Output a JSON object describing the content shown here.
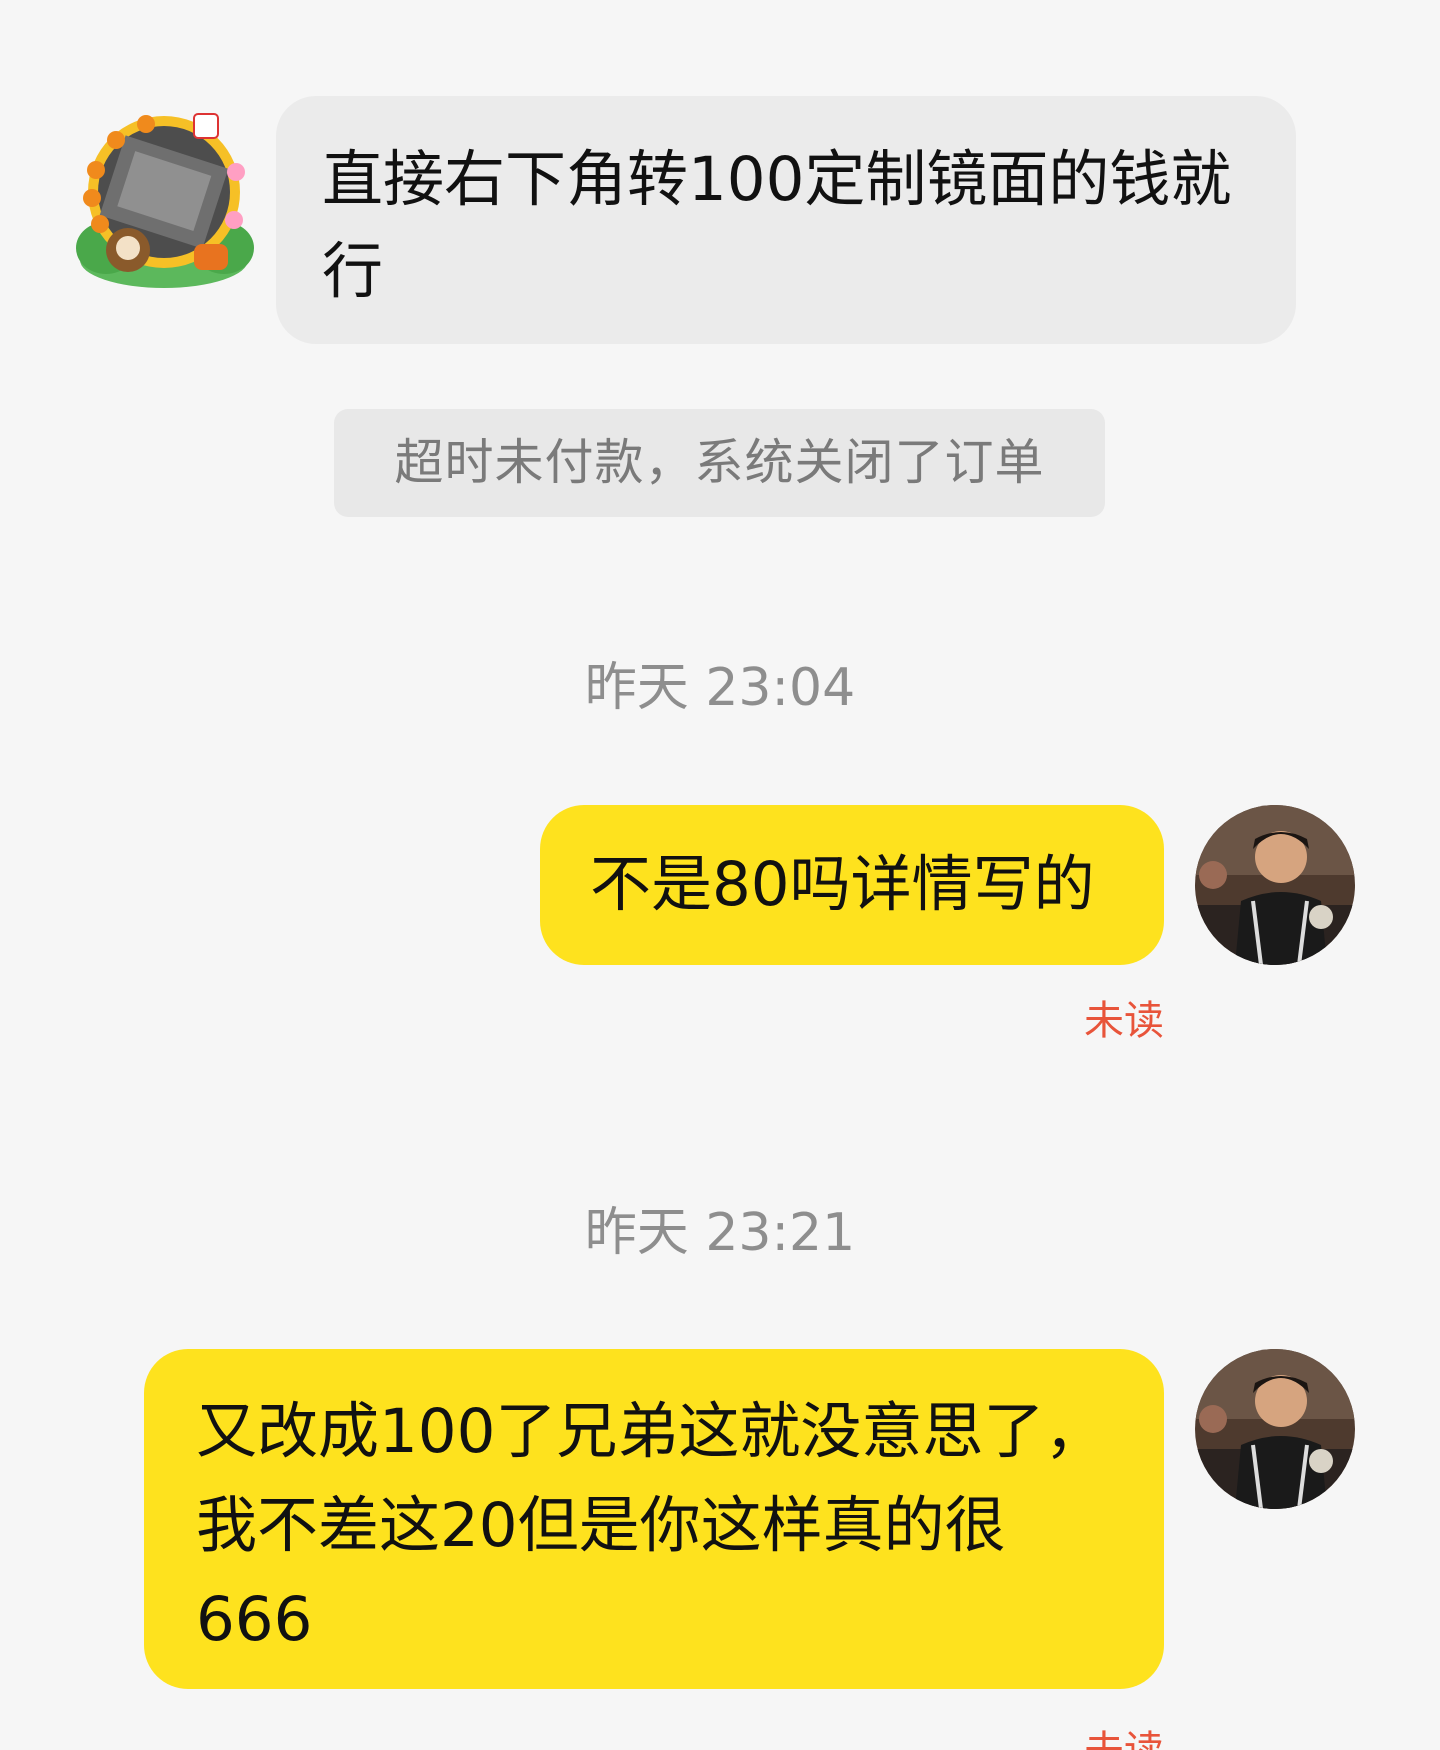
{
  "conversation": {
    "incoming_message": {
      "avatar": "decorated-avatar-icon",
      "text": "直接右下角转100定制镜面的钱就行"
    },
    "system_notice": "超时未付款，系统关闭了订单",
    "timestamp_1": "昨天 23:04",
    "outgoing_message_1": {
      "text": "不是80吗详情写的",
      "status": "未读",
      "avatar": "user-photo-avatar-icon"
    },
    "timestamp_2": "昨天 23:21",
    "outgoing_message_2": {
      "text": "又改成100了兄弟这就没意思了，我不差这20但是你这样真的很666",
      "status": "未读",
      "avatar": "user-photo-avatar-icon"
    }
  },
  "colors": {
    "background": "#f6f6f6",
    "incoming_bubble": "#ebebeb",
    "outgoing_bubble": "#fee21e",
    "unread": "#e8543a",
    "timestamp": "#8e8e8e"
  }
}
